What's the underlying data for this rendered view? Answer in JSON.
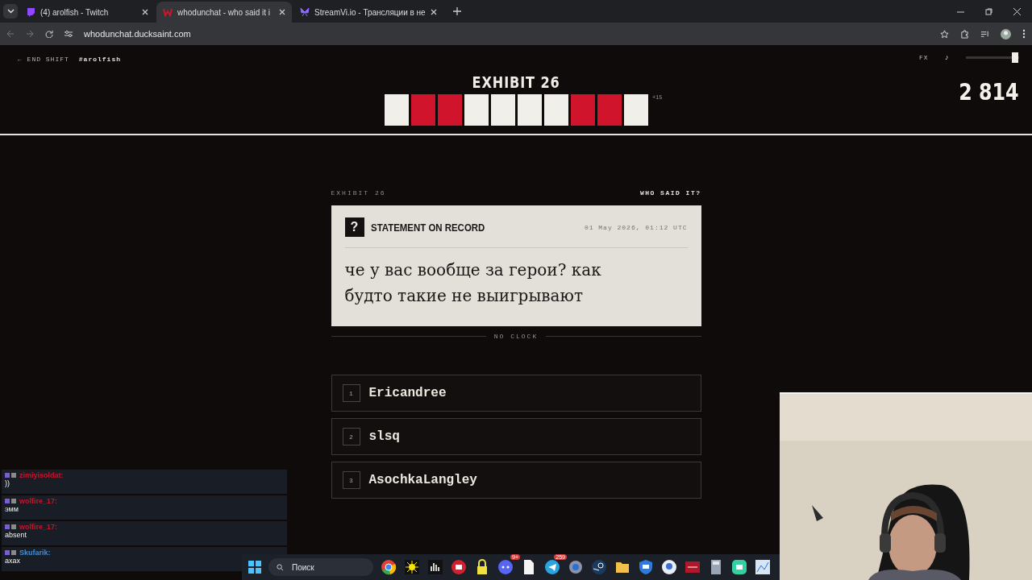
{
  "browser": {
    "tabs": [
      {
        "title": "(4) arolfish - Twitch",
        "kind": "twitch",
        "selected": false
      },
      {
        "title": "whodunchat - who said it i",
        "kind": "w",
        "selected": true
      },
      {
        "title": "StreamVi.io - Трансляции в не",
        "kind": "streamvi",
        "selected": false
      }
    ],
    "url": "whodunchat.ducksaint.com"
  },
  "header": {
    "end_shift": "← END SHIFT",
    "channel": "#arolfish",
    "fx": "FX",
    "music": "♪",
    "volume": {
      "level": 0.93
    },
    "title": "EXHIBIT 26",
    "bonus": "+15",
    "score": "2 814",
    "history": [
      {
        "color": "#f1efe9"
      },
      {
        "color": "#d0142c"
      },
      {
        "color": "#d0142c"
      },
      {
        "color": "#f1efe9"
      },
      {
        "color": "#f1efe9"
      },
      {
        "color": "#f1efe9"
      },
      {
        "color": "#f1efe9"
      },
      {
        "color": "#d0142c"
      },
      {
        "color": "#d0142c"
      },
      {
        "color": "#f1efe9"
      }
    ]
  },
  "question": {
    "exhibit": "EXHIBIT 26",
    "prompt": "WHO SAID IT?",
    "badge": "?",
    "heading": "STATEMENT ON RECORD",
    "timestamp": "01 May 2026, 01:12 UTC",
    "quote": "че у вас вообще за герои? как будто такие не выигрывают",
    "timer": "NO CLOCK"
  },
  "options": [
    {
      "number": "1",
      "name": "Ericandree"
    },
    {
      "number": "2",
      "name": "slsq"
    },
    {
      "number": "3",
      "name": "AsochkaLangley"
    }
  ],
  "chat": [
    {
      "user": "zimiyisoldat:",
      "text": "))",
      "color": "#c8152b"
    },
    {
      "user": "wolfire_17:",
      "text": "эмм",
      "color": "#c8152b"
    },
    {
      "user": "wolfire_17:",
      "text": "absent",
      "color": "#c8152b"
    },
    {
      "user": "Skufarik:",
      "text": "axax",
      "color": "#3d8fe0"
    }
  ],
  "taskbar": {
    "search": "Поиск",
    "apps": [
      {
        "kind": "chrome"
      },
      {
        "kind": "burst"
      },
      {
        "kind": "bars"
      },
      {
        "kind": "redcircle"
      },
      {
        "kind": "lock"
      },
      {
        "kind": "discord",
        "badge": "9+"
      },
      {
        "kind": "file"
      },
      {
        "kind": "telegram",
        "badge": "259"
      },
      {
        "kind": "gear"
      },
      {
        "kind": "steam"
      },
      {
        "kind": "folder"
      },
      {
        "kind": "shield"
      },
      {
        "kind": "bubble"
      },
      {
        "kind": "redapp"
      },
      {
        "kind": "calc"
      },
      {
        "kind": "greenapp"
      },
      {
        "kind": "chart"
      }
    ]
  }
}
